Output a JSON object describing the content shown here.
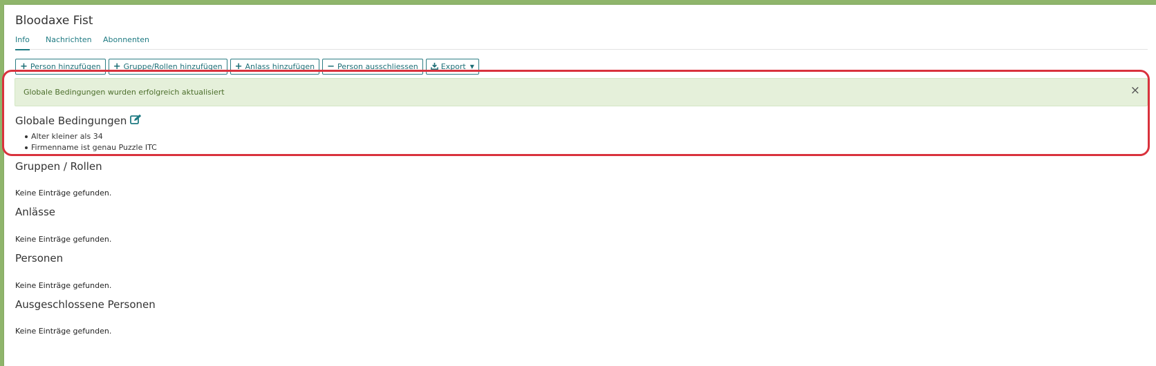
{
  "header": {
    "title": "Bloodaxe Fist"
  },
  "tabs": [
    {
      "label": "Info"
    },
    {
      "label": "Nachrichten"
    },
    {
      "label": "Abonnenten"
    }
  ],
  "toolbar": {
    "add_person": "Person hinzufügen",
    "add_group_roles": "Gruppe/Rollen hinzufügen",
    "add_event": "Anlass hinzufügen",
    "exclude_person": "Person ausschliessen",
    "export": "Export"
  },
  "alert": {
    "message": "Globale Bedingungen wurden erfolgreich aktualisiert",
    "close_symbol": "×"
  },
  "global_conditions": {
    "title": "Globale Bedingungen",
    "items": [
      "Alter kleiner als 34",
      "Firmenname ist genau Puzzle ITC"
    ]
  },
  "sections": [
    {
      "title": "Gruppen / Rollen",
      "empty": "Keine Einträge gefunden."
    },
    {
      "title": "Anlässe",
      "empty": "Keine Einträge gefunden."
    },
    {
      "title": "Personen",
      "empty": "Keine Einträge gefunden."
    },
    {
      "title": "Ausgeschlossene Personen",
      "empty": "Keine Einträge gefunden."
    }
  ],
  "colors": {
    "accent": "#1e7a82",
    "alert_bg": "#e5f0da",
    "highlight": "#d9323d",
    "frame_bg": "#8fb56b"
  },
  "icons": {
    "add": "plus-icon",
    "remove": "minus-icon",
    "export": "download-icon",
    "edit": "edit-icon",
    "close": "close-icon"
  }
}
